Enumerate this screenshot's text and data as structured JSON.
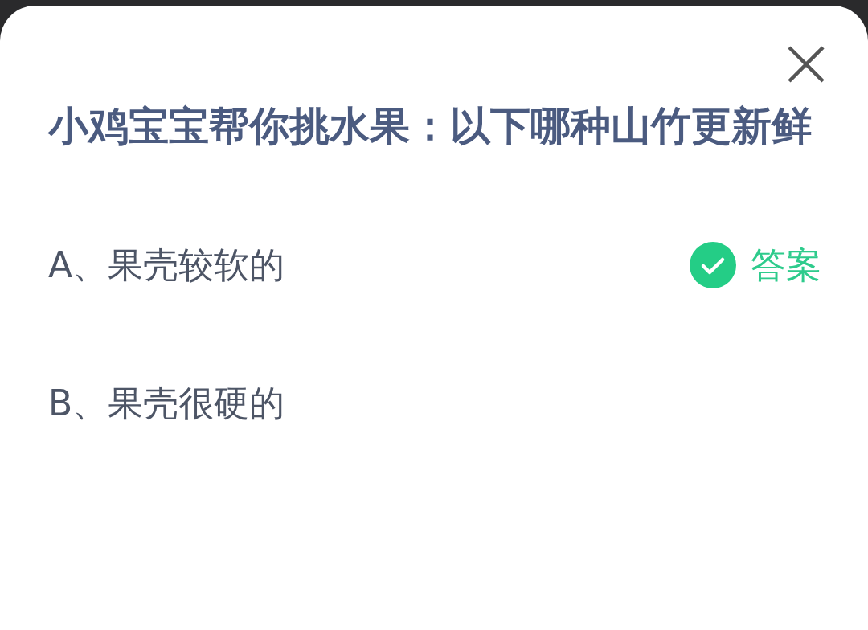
{
  "question": "小鸡宝宝帮你挑水果：以下哪种山竹更新鲜",
  "answer_label": "答案",
  "options": [
    {
      "text": "A、果壳较软的",
      "is_answer": true
    },
    {
      "text": "B、果壳很硬的",
      "is_answer": false
    }
  ]
}
